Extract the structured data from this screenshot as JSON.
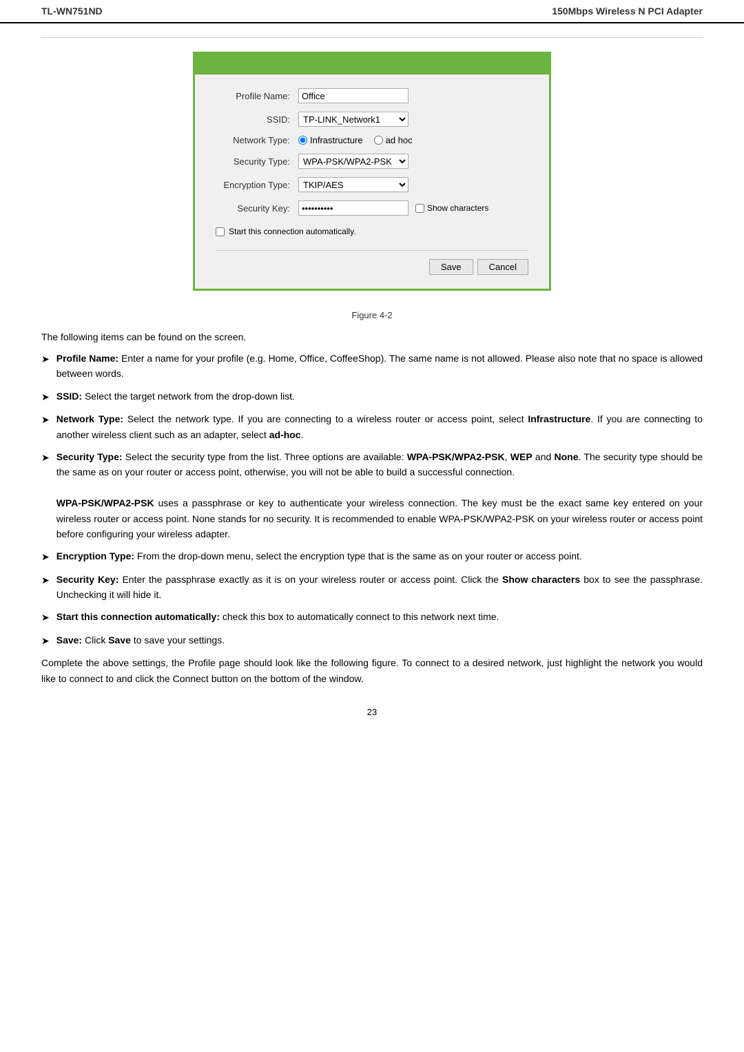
{
  "header": {
    "product_code": "TL-WN751ND",
    "product_name": "150Mbps Wireless N PCI Adapter"
  },
  "dialog": {
    "fields": {
      "profile_name_label": "Profile Name:",
      "profile_name_value": "Office",
      "ssid_label": "SSID:",
      "ssid_value": "TP-LINK_Network1",
      "network_type_label": "Network Type:",
      "network_type_infrastructure": "Infrastructure",
      "network_type_adhoc": "ad hoc",
      "security_type_label": "Security Type:",
      "security_type_value": "WPA-PSK/WPA2-PSK",
      "encryption_type_label": "Encryption Type:",
      "encryption_type_value": "TKIP/AES",
      "security_key_label": "Security Key:",
      "security_key_value": "**********",
      "show_characters_label": "Show characters"
    },
    "auto_connect_label": "Start this connection automatically.",
    "save_button": "Save",
    "cancel_button": "Cancel"
  },
  "figure_caption": "Figure 4-2",
  "description_intro": "The following items can be found on the screen.",
  "bullets": [
    {
      "label": "Profile Name:",
      "text": " Enter a name for your profile (e.g. Home, Office, CoffeeShop). The same name is not allowed. Please also note that no space is allowed between words."
    },
    {
      "label": "SSID:",
      "text": " Select the target network from the drop-down list."
    },
    {
      "label": "Network Type:",
      "text": " Select the network type. If you are connecting to a wireless router or access point, select Infrastructure. If you are connecting to another wireless client such as an adapter, select ad-hoc."
    },
    {
      "label": "Security Type:",
      "text": " Select the security type from the list. Three options are available: WPA-PSK/WPA2-PSK, WEP and None. The security type should be the same as on your router or access point, otherwise, you will not be able to build a successful connection."
    },
    {
      "label": "WPA-PSK/WPA2-PSK",
      "text": " uses a passphrase or key to authenticate your wireless connection. The key must be the exact same key entered on your wireless router or access point. None stands for no security. It is recommended to enable WPA-PSK/WPA2-PSK on your wireless router or access point before configuring your wireless adapter.",
      "is_continuation": true
    },
    {
      "label": "Encryption Type:",
      "text": " From the drop-down menu, select the encryption type that is the same as on your router or access point."
    },
    {
      "label": "Security Key:",
      "text": " Enter the passphrase exactly as it is on your wireless router or access point. Click the Show characters box to see the passphrase. Unchecking it will hide it."
    },
    {
      "label": "Start this connection automatically:",
      "text": " check this box to automatically connect to this network next time."
    },
    {
      "label": "Save:",
      "text": " Click Save to save your settings."
    }
  ],
  "closing_para": "Complete the above settings, the Profile page should look like the following figure. To connect to a desired network, just highlight the network you would like to connect to and click the Connect button on the bottom of the window.",
  "page_number": "23"
}
